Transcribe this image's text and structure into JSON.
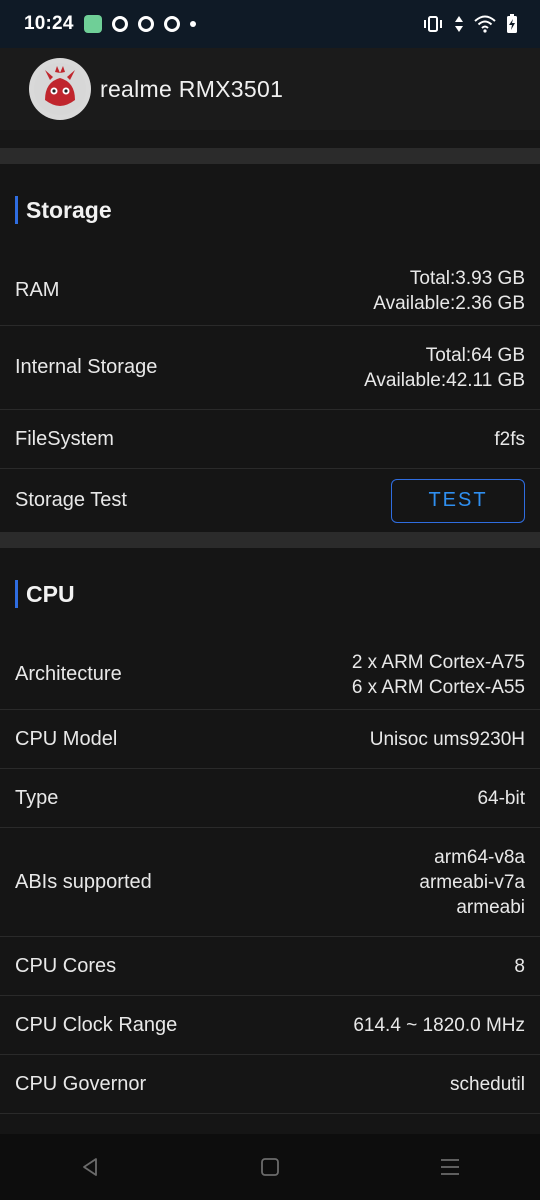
{
  "status_bar": {
    "time": "10:24"
  },
  "header": {
    "device_name": "realme RMX3501"
  },
  "storage": {
    "title": "Storage",
    "ram": {
      "label": "RAM",
      "total": "Total:3.93 GB",
      "available": "Available:2.36 GB"
    },
    "internal": {
      "label": "Internal Storage",
      "total": "Total:64 GB",
      "available": "Available:42.11 GB"
    },
    "filesystem": {
      "label": "FileSystem",
      "value": "f2fs"
    },
    "test": {
      "label": "Storage Test",
      "button": "TEST"
    }
  },
  "cpu": {
    "title": "CPU",
    "architecture": {
      "label": "Architecture",
      "line1": "2 x ARM Cortex-A75",
      "line2": "6 x ARM Cortex-A55"
    },
    "model": {
      "label": "CPU Model",
      "value": "Unisoc ums9230H"
    },
    "type": {
      "label": "Type",
      "value": "64-bit"
    },
    "abis": {
      "label": "ABIs supported",
      "values": [
        "arm64-v8a",
        "armeabi-v7a",
        "armeabi"
      ]
    },
    "cores": {
      "label": "CPU Cores",
      "value": "8"
    },
    "clock": {
      "label": "CPU Clock Range",
      "value": "614.4 ~ 1820.0 MHz"
    },
    "governor": {
      "label": "CPU Governor",
      "value": "schedutil"
    }
  },
  "colors": {
    "accent": "#2f6de0",
    "background": "#121212",
    "card": "#151515"
  },
  "icons": [
    "app-notification-icon",
    "vibrate-icon",
    "data-arrows-icon",
    "wifi-icon",
    "battery-icon",
    "antutu-logo",
    "back-icon",
    "home-icon",
    "recents-icon"
  ]
}
